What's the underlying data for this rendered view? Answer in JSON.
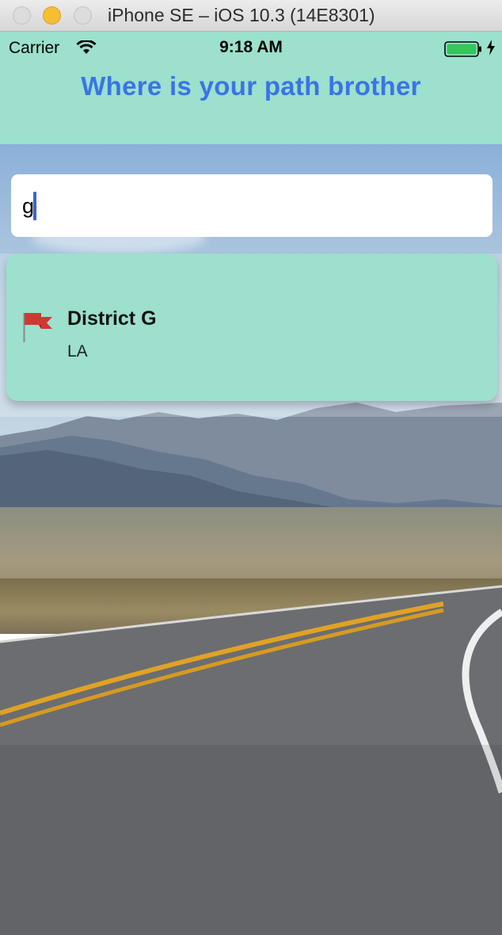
{
  "window": {
    "title": "iPhone SE – iOS 10.3 (14E8301)"
  },
  "status_bar": {
    "carrier": "Carrier",
    "time": "9:18 AM",
    "battery_color": "#34c759"
  },
  "header": {
    "title": "Where is your path brother",
    "background": "#9ce0cd",
    "title_color": "#3a74e6"
  },
  "search": {
    "value": "g",
    "placeholder": ""
  },
  "results": [
    {
      "icon": "flag-icon",
      "name": "District G",
      "subtitle": "LA"
    }
  ],
  "background_image": "desert-road-photo"
}
